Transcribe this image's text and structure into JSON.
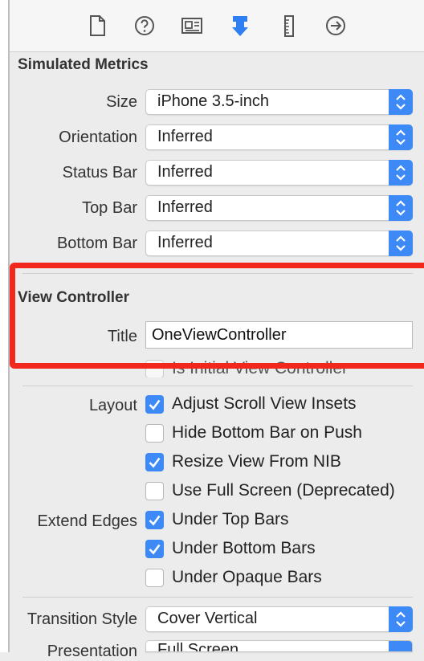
{
  "toolbar": {
    "icons": [
      "file-icon",
      "help-icon",
      "identity-icon",
      "attributes-icon",
      "size-ruler-icon",
      "connections-icon"
    ]
  },
  "simulated_metrics": {
    "title": "Simulated Metrics",
    "rows": [
      {
        "label": "Size",
        "value": "iPhone 3.5-inch"
      },
      {
        "label": "Orientation",
        "value": "Inferred"
      },
      {
        "label": "Status Bar",
        "value": "Inferred"
      },
      {
        "label": "Top Bar",
        "value": "Inferred"
      },
      {
        "label": "Bottom Bar",
        "value": "Inferred"
      }
    ]
  },
  "view_controller": {
    "title": "View Controller",
    "title_label": "Title",
    "title_value": "OneViewController",
    "initial_vc_label": "Is Initial View Controller"
  },
  "layout": {
    "label": "Layout",
    "options": [
      {
        "label": "Adjust Scroll View Insets",
        "checked": true
      },
      {
        "label": "Hide Bottom Bar on Push",
        "checked": false
      },
      {
        "label": "Resize View From NIB",
        "checked": true
      },
      {
        "label": "Use Full Screen (Deprecated)",
        "checked": false
      }
    ]
  },
  "extend_edges": {
    "label": "Extend Edges",
    "options": [
      {
        "label": "Under Top Bars",
        "checked": true
      },
      {
        "label": "Under Bottom Bars",
        "checked": true
      },
      {
        "label": "Under Opaque Bars",
        "checked": false
      }
    ]
  },
  "transition": {
    "label": "Transition Style",
    "value": "Cover Vertical"
  },
  "presentation": {
    "label": "Presentation",
    "value": "Full Screen"
  },
  "colors": {
    "accent": "#3d8af7",
    "highlight": "#f2281c"
  }
}
